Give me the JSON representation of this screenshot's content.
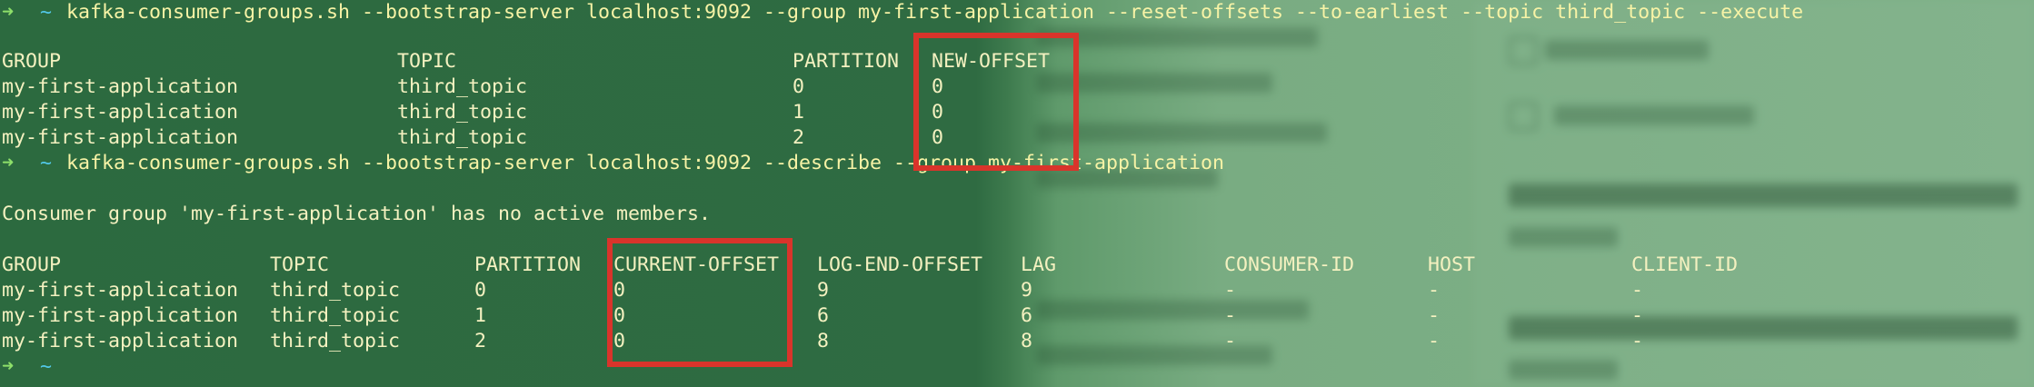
{
  "session": {
    "prompt_arrow": "➜",
    "prompt_tilde": "~",
    "command_1": "kafka-consumer-groups.sh --bootstrap-server localhost:9092 --group my-first-application --reset-offsets --to-earliest --topic third_topic --execute",
    "command_2": "kafka-consumer-groups.sh --bootstrap-server localhost:9092 --describe --group my-first-application",
    "message": "Consumer group 'my-first-application' has no active members."
  },
  "reset_table": {
    "headers": [
      "GROUP",
      "TOPIC",
      "PARTITION",
      "NEW-OFFSET"
    ],
    "rows": [
      [
        "my-first-application",
        "third_topic",
        "0",
        "0"
      ],
      [
        "my-first-application",
        "third_topic",
        "1",
        "0"
      ],
      [
        "my-first-application",
        "third_topic",
        "2",
        "0"
      ]
    ]
  },
  "describe_table": {
    "headers": [
      "GROUP",
      "TOPIC",
      "PARTITION",
      "CURRENT-OFFSET",
      "LOG-END-OFFSET",
      "LAG",
      "CONSUMER-ID",
      "HOST",
      "CLIENT-ID"
    ],
    "rows": [
      [
        "my-first-application",
        "third_topic",
        "0",
        "0",
        "9",
        "9",
        "-",
        "-",
        "-"
      ],
      [
        "my-first-application",
        "third_topic",
        "1",
        "0",
        "6",
        "6",
        "-",
        "-",
        "-"
      ],
      [
        "my-first-application",
        "third_topic",
        "2",
        "0",
        "8",
        "8",
        "-",
        "-",
        "-"
      ]
    ]
  },
  "colors": {
    "terminal_background": "#2f6a40",
    "text": "#f4f1c0",
    "command_text": "#f7f3a6",
    "prompt_arrow": "#8ee06a",
    "prompt_tilde": "#52c8e8",
    "highlight_border": "#d9342b"
  }
}
